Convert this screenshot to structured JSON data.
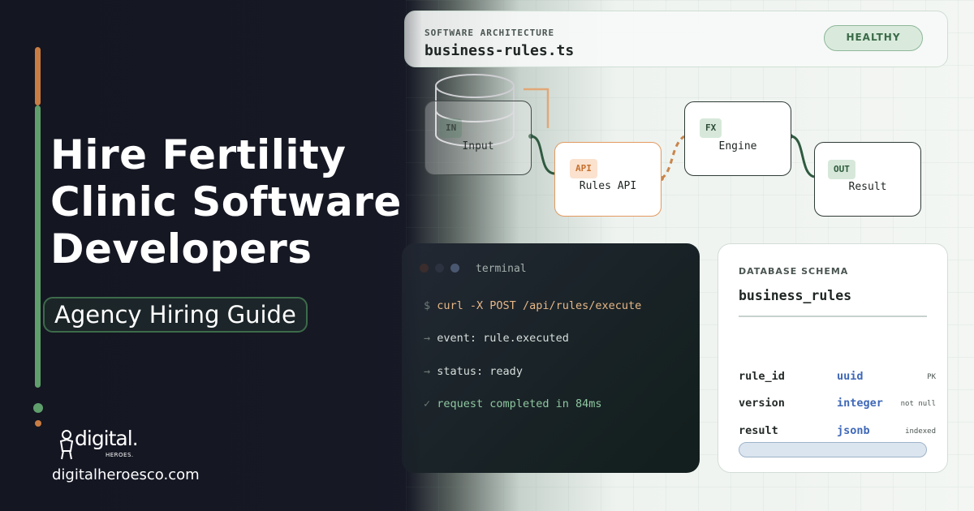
{
  "hero": {
    "headline_lines": [
      "Hire Fertility",
      "Clinic Software",
      "Developers"
    ],
    "tagline": "Agency Hiring Guide",
    "brand": "digital.",
    "brand_sub": "HEROES.",
    "site_url": "digitalheroesco.com"
  },
  "colors": {
    "accent_orange": "#c97d43",
    "accent_green": "#5f9f6c",
    "dark_bg": "#151724",
    "light_bg": "#f3f6f3",
    "type_blue": "#3f68b8"
  },
  "header_card": {
    "eyebrow": "SOFTWARE ARCHITECTURE",
    "title": "business-rules.ts",
    "status": "HEALTHY"
  },
  "flow": {
    "nodes": [
      {
        "tag": "IN",
        "label": "Input"
      },
      {
        "tag": "API",
        "label": "Rules API"
      },
      {
        "tag": "FX",
        "label": "Engine"
      },
      {
        "tag": "OUT",
        "label": "Result"
      }
    ]
  },
  "terminal": {
    "title": "terminal",
    "lines": [
      {
        "prefix": "$",
        "text": "curl -X POST /api/rules/execute"
      },
      {
        "prefix": "→",
        "text": "event: rule.executed"
      },
      {
        "prefix": "→",
        "text": "status: ready"
      },
      {
        "prefix": "✓",
        "text": "request completed in 84ms"
      }
    ]
  },
  "schema": {
    "eyebrow": "DATABASE SCHEMA",
    "title": "business_rules",
    "rows": [
      {
        "name": "rule_id",
        "type": "uuid",
        "attr": "PK"
      },
      {
        "name": "version",
        "type": "integer",
        "attr": "not null"
      },
      {
        "name": "result",
        "type": "jsonb",
        "attr": "indexed"
      }
    ]
  }
}
